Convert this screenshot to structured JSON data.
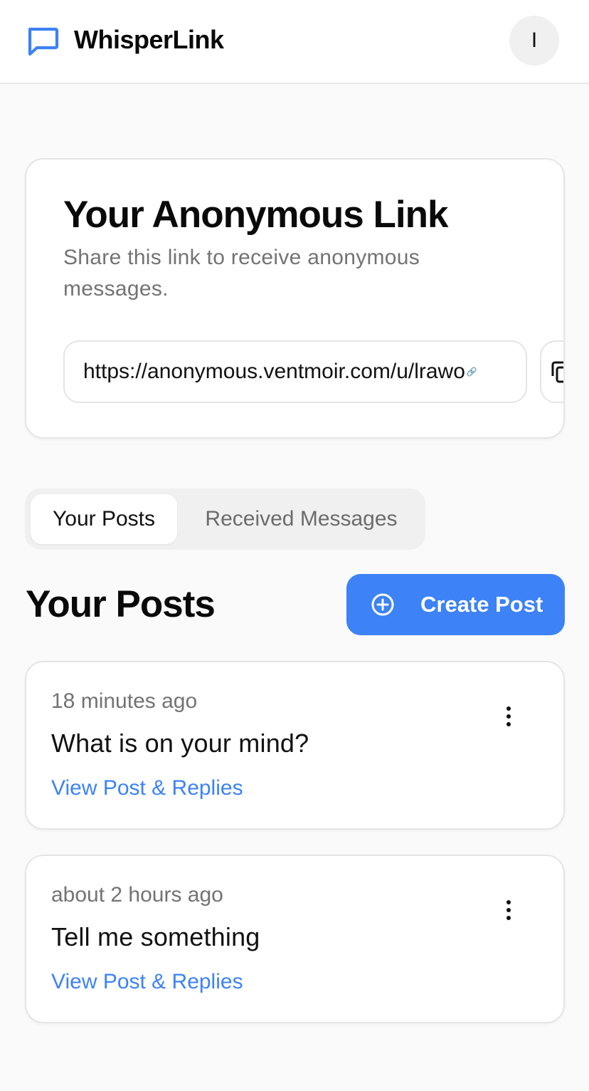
{
  "header": {
    "brand": "WhisperLink",
    "avatar_initial": "I",
    "brand_icon": "message-square-icon"
  },
  "link_card": {
    "title": "Your Anonymous Link",
    "description": "Share this link to receive anonymous messages.",
    "url": "https://anonymous.ventmoir.com/u/lrawo",
    "copy_icon": "copy-icon"
  },
  "tabs": [
    {
      "label": "Your Posts",
      "active": true
    },
    {
      "label": "Received Messages",
      "active": false
    }
  ],
  "section": {
    "title": "Your Posts",
    "create_label": "Create Post",
    "create_icon": "plus-circle-icon"
  },
  "posts": [
    {
      "time": "18 minutes ago",
      "text": "What is on your mind?",
      "link": "View Post & Replies"
    },
    {
      "time": "about 2 hours ago",
      "text": "Tell me something",
      "link": "View Post & Replies"
    }
  ],
  "colors": {
    "accent": "#3d82f6",
    "muted": "#737373",
    "background": "#fafafa"
  }
}
